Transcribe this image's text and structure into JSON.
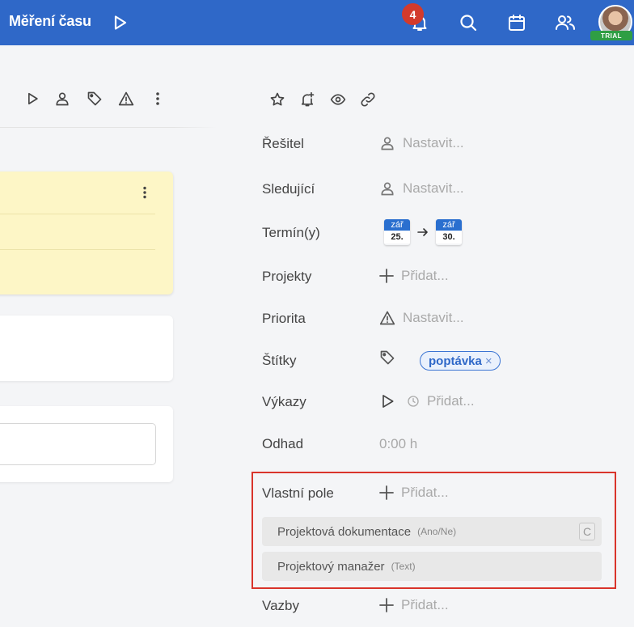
{
  "topbar": {
    "title": "Měření času",
    "notifications_count": "4",
    "trial_label": "TRIAL",
    "icons": [
      "play-icon",
      "bell-icon",
      "search-icon",
      "calendar-icon",
      "users-icon"
    ]
  },
  "left_toolbar": {
    "icons": [
      "play-icon",
      "person-icon",
      "tag-icon",
      "warning-icon",
      "more-vertical-icon"
    ]
  },
  "right_toolbar": {
    "icons": [
      "star-icon",
      "bell-plus-icon",
      "eye-icon",
      "link-icon"
    ]
  },
  "properties": {
    "assignee": {
      "label": "Řešitel",
      "value": "Nastavit..."
    },
    "followers": {
      "label": "Sledující",
      "value": "Nastavit..."
    },
    "dates": {
      "label": "Termín(y)",
      "start_month": "zář",
      "start_day": "25.",
      "end_month": "zář",
      "end_day": "30."
    },
    "projects": {
      "label": "Projekty",
      "value": "Přidat..."
    },
    "priority": {
      "label": "Priorita",
      "value": "Nastavit..."
    },
    "tags": {
      "label": "Štítky",
      "tag": "poptávka",
      "remove": "×"
    },
    "reports": {
      "label": "Výkazy",
      "value": "Přidat..."
    },
    "estimate": {
      "label": "Odhad",
      "value": "0:00 h"
    },
    "custom_fields": {
      "label": "Vlastní pole",
      "value": "Přidat...",
      "items": [
        {
          "name": "Projektová dokumentace",
          "type": "(Ano/Ne)",
          "shortcut": "C"
        },
        {
          "name": "Projektový manažer",
          "type": "(Text)"
        }
      ]
    },
    "links": {
      "label": "Vazby",
      "value": "Přidat..."
    }
  },
  "colors": {
    "topbar": "#2f68c8",
    "accent": "#2f68c8",
    "highlight": "#d9342b",
    "badge": "#d33a2c",
    "trial": "#2f9e44"
  }
}
